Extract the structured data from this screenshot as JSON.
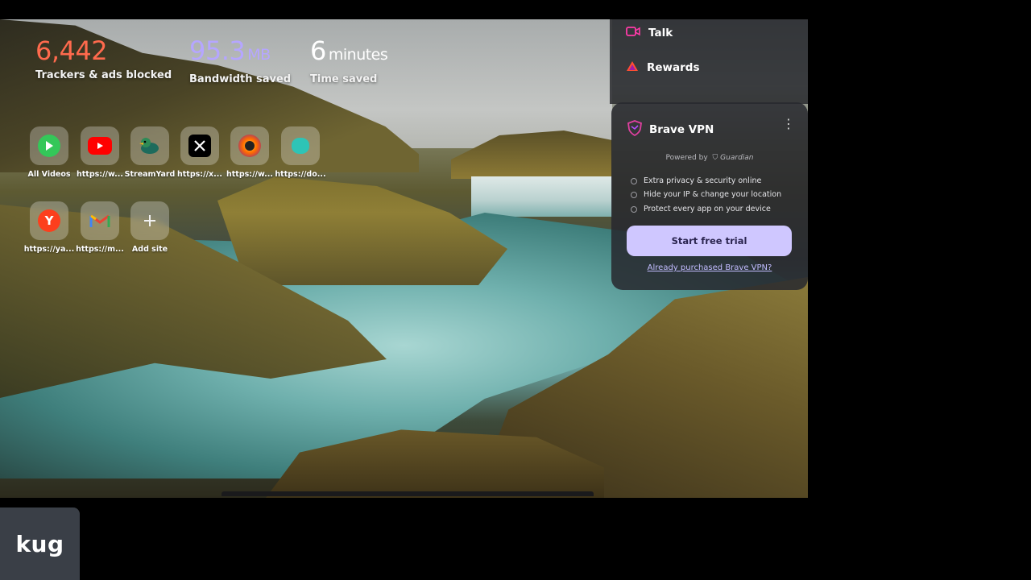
{
  "stats": {
    "trackers": {
      "value": "6,442",
      "label": "Trackers & ads blocked"
    },
    "bandwidth": {
      "value": "95.3",
      "unit": "MB",
      "label": "Bandwidth saved"
    },
    "time": {
      "value": "6",
      "unit": "minutes",
      "label": "Time saved"
    }
  },
  "top_sites": [
    {
      "label": "All Videos",
      "icon": "play-icon"
    },
    {
      "label": "https://w...",
      "icon": "youtube-icon"
    },
    {
      "label": "StreamYard",
      "icon": "duck-icon"
    },
    {
      "label": "https://x...",
      "icon": "x-icon"
    },
    {
      "label": "https://w...",
      "icon": "camera-icon"
    },
    {
      "label": "https://do...",
      "icon": "teal-circle-icon"
    },
    {
      "label": "https://ya...",
      "icon": "yandex-icon"
    },
    {
      "label": "https://m...",
      "icon": "gmail-icon"
    },
    {
      "label": "Add site",
      "icon": "plus-icon"
    }
  ],
  "panel": {
    "talk": "Talk",
    "rewards": "Rewards"
  },
  "vpn": {
    "title": "Brave VPN",
    "menu": "⋮",
    "powered_by": "Powered by",
    "partner": "Guardian",
    "features": [
      "Extra privacy & security online",
      "Hide your IP & change your location",
      "Protect every app on your device"
    ],
    "cta": "Start free trial",
    "already_link": "Already purchased Brave VPN?"
  },
  "badge": {
    "text": "kug"
  },
  "colors": {
    "trackers": "#ff6a4d",
    "bandwidth": "#b5a6ff",
    "cta_bg": "#cfc7ff",
    "link": "#c2bcff"
  }
}
